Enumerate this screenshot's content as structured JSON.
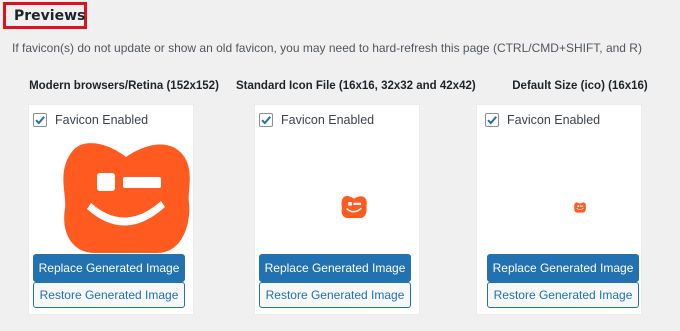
{
  "header": {
    "title": "Previews",
    "hint": "If favicon(s) do not update or show an old favicon, you may need to hard-refresh this page (CTRL/CMD+SHIFT, and R)"
  },
  "columns": [
    {
      "heading": "Modern browsers/Retina (152x152)",
      "checkbox_label": "Favicon Enabled",
      "checked": true,
      "replace_label": "Replace Generated Image",
      "restore_label": "Restore Generated Image",
      "icon": "logo-face-icon"
    },
    {
      "heading": "Standard Icon File (16x16, 32x32 and 42x42)",
      "checkbox_label": "Favicon Enabled",
      "checked": true,
      "replace_label": "Replace Generated Image",
      "restore_label": "Restore Generated Image",
      "icon": "logo-face-icon"
    },
    {
      "heading": "Default Size (ico) (16x16)",
      "checkbox_label": "Favicon Enabled",
      "checked": true,
      "replace_label": "Replace Generated Image",
      "restore_label": "Restore Generated Image",
      "icon": "logo-face-icon"
    }
  ],
  "colors": {
    "accent": "#2271b1",
    "logo": "#ff5a1f",
    "highlight_border": "#d9141b"
  }
}
